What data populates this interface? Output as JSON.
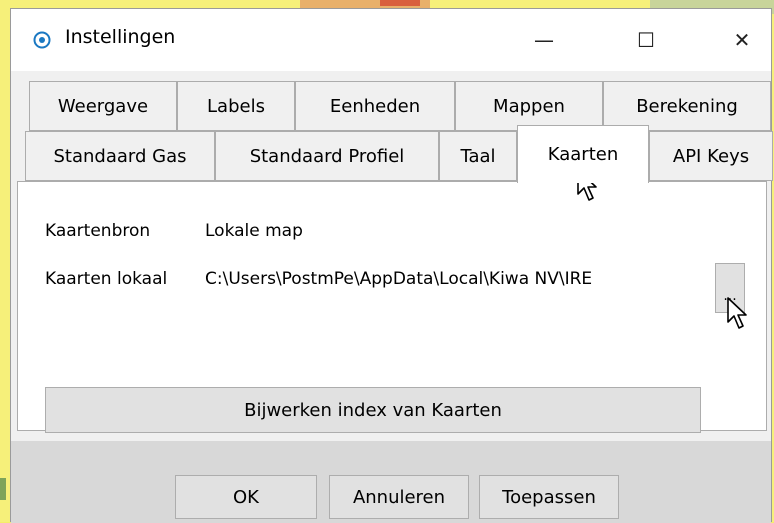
{
  "window": {
    "title": "Instellingen",
    "minimize_glyph": "—",
    "maximize_glyph": "☐",
    "close_glyph": "✕",
    "app_icon": "settings-circle-icon",
    "accent_color": "#1a78c2"
  },
  "tabs": {
    "row1": [
      "Weergave",
      "Labels",
      "Eenheden",
      "Mappen",
      "Berekening"
    ],
    "row2": [
      "Standaard Gas",
      "Standaard Profiel",
      "Taal",
      "Kaarten",
      "API Keys"
    ],
    "active": "Kaarten"
  },
  "kaarten": {
    "source_label": "Kaartenbron",
    "source_value": "Lokale map",
    "local_label": "Kaarten lokaal",
    "local_value": "C:\\Users\\PostmPe\\AppData\\Local\\Kiwa NV\\IRE",
    "browse_label": "...",
    "update_index_label": "Bijwerken index van Kaarten"
  },
  "footer": {
    "ok_label": "OK",
    "cancel_label": "Annuleren",
    "apply_label": "Toepassen"
  }
}
